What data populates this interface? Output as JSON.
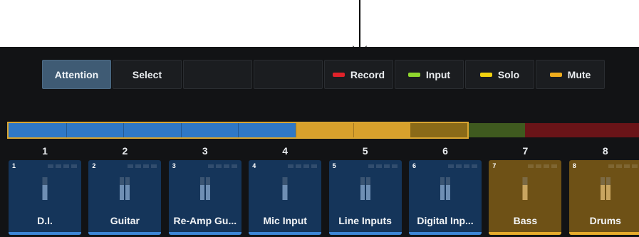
{
  "toolbar": {
    "buttons": [
      {
        "label": "Attention",
        "active": true
      },
      {
        "label": "Select"
      },
      {
        "label": ""
      },
      {
        "label": ""
      },
      {
        "label": "Record",
        "swatch": "#e0222a"
      },
      {
        "label": "Input",
        "swatch": "#8fd62e"
      },
      {
        "label": "Solo",
        "swatch": "#f2d20f"
      },
      {
        "label": "Mute",
        "swatch": "#f0ad1d"
      }
    ]
  },
  "bank": {
    "segments": [
      {
        "color": "#2f78c6"
      },
      {
        "color": "#2f78c6"
      },
      {
        "color": "#2f78c6"
      },
      {
        "color": "#2f78c6"
      },
      {
        "color": "#2f78c6"
      },
      {
        "color": "#d8a12c"
      },
      {
        "color": "#d8a12c"
      },
      {
        "color": "#8a6a18"
      },
      {
        "color": "#3f5a1f"
      },
      {
        "color": "#6a1418"
      }
    ]
  },
  "channels": [
    {
      "number": "1",
      "name": "D.I.",
      "type": "mono",
      "color": "blue"
    },
    {
      "number": "2",
      "name": "Guitar",
      "type": "stereo",
      "color": "blue"
    },
    {
      "number": "3",
      "name": "Re-Amp Gu...",
      "type": "stereo",
      "color": "blue"
    },
    {
      "number": "4",
      "name": "Mic Input",
      "type": "mono",
      "color": "blue"
    },
    {
      "number": "5",
      "name": "Line Inputs",
      "type": "stereo",
      "color": "blue"
    },
    {
      "number": "6",
      "name": "Digital Inp...",
      "type": "stereo",
      "color": "blue"
    },
    {
      "number": "7",
      "name": "Bass",
      "type": "mono",
      "color": "amber"
    },
    {
      "number": "8",
      "name": "Drums",
      "type": "stereo",
      "color": "amber"
    }
  ],
  "colors": {
    "blue_tile": "#15355a",
    "blue_line": "#3d86d6",
    "amber_tile": "#6e5116",
    "amber_line": "#e5ab2c"
  }
}
